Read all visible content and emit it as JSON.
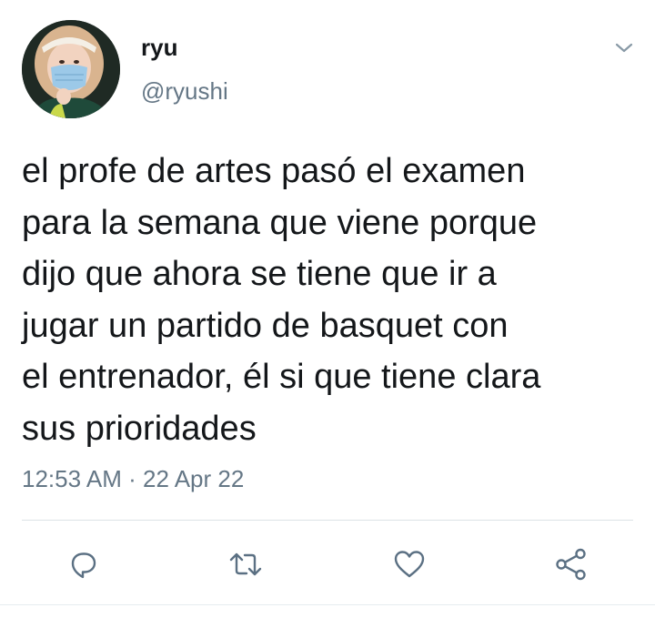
{
  "tweet": {
    "display_name": "ryu",
    "handle": "@ryushi",
    "text": "el profe de artes pasó el examen\npara la semana que viene porque\ndijo que ahora se tiene que ir a\njugar un partido de basquet con\nel entrenador, él si que tiene clara\nsus prioridades",
    "time": "12:53 AM",
    "separator": "·",
    "date": "22 Apr 22"
  },
  "icons": {
    "menu": "chevron-down-icon",
    "reply": "reply-icon",
    "retweet": "retweet-icon",
    "like": "heart-icon",
    "share": "share-icon"
  },
  "colors": {
    "text": "#14171a",
    "secondary": "#657786",
    "icon": "#5b7083",
    "divider": "#dde2e6"
  }
}
